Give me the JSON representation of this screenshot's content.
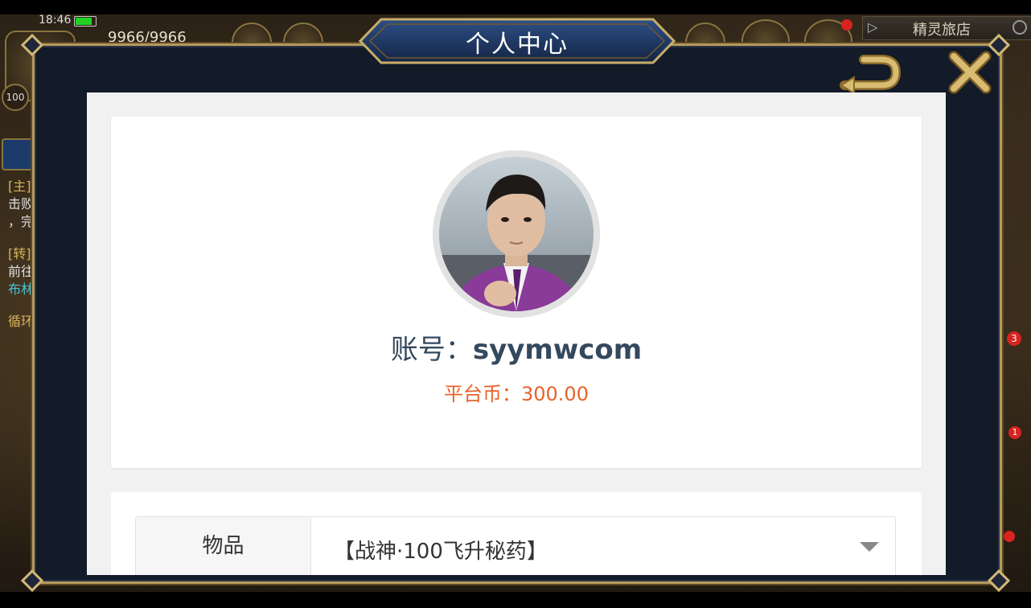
{
  "status_bar": {
    "time": "18:46",
    "battery_level": 0.85
  },
  "hud": {
    "hp_text": "9966/9966",
    "inn_label": "精灵旅店",
    "level_badge": "100",
    "side_lines": [
      "[主]",
      "击败",
      "，完",
      "[转]",
      "前往",
      "布林",
      "循环"
    ],
    "notification_counts": [
      "3",
      "1"
    ]
  },
  "dialog": {
    "title": "个人中心",
    "back_icon": "return-arrow-icon",
    "close_icon": "close-icon"
  },
  "profile": {
    "account_label": "账号：",
    "username": "syymwcom",
    "coin_text": "平台币：300.00",
    "avatar_icon": "avatar-photo"
  },
  "item_form": {
    "label": "物品",
    "selected_value": "【战神·100飞升秘药】"
  },
  "colors": {
    "dialog_bg": "#131a28",
    "frame_gold": "#b59a5a",
    "coin_orange": "#e8622a",
    "account_text": "#34495e"
  }
}
